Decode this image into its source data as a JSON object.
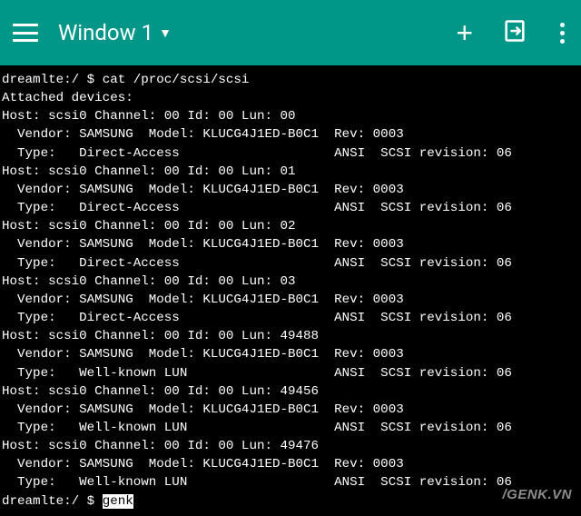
{
  "header": {
    "title": "Window 1"
  },
  "terminal": {
    "prompt1": "dreamlte:/ $ ",
    "command1": "cat /proc/scsi/scsi",
    "attached_line": "Attached devices:",
    "devices": [
      {
        "hostline": "Host: scsi0 Channel: 00 Id: 00 Lun: 00",
        "vendorline": "  Vendor: SAMSUNG  Model: KLUCG4J1ED-B0C1  Rev: 0003",
        "typeline": "  Type:   Direct-Access                    ANSI  SCSI revision: 06"
      },
      {
        "hostline": "Host: scsi0 Channel: 00 Id: 00 Lun: 01",
        "vendorline": "  Vendor: SAMSUNG  Model: KLUCG4J1ED-B0C1  Rev: 0003",
        "typeline": "  Type:   Direct-Access                    ANSI  SCSI revision: 06"
      },
      {
        "hostline": "Host: scsi0 Channel: 00 Id: 00 Lun: 02",
        "vendorline": "  Vendor: SAMSUNG  Model: KLUCG4J1ED-B0C1  Rev: 0003",
        "typeline": "  Type:   Direct-Access                    ANSI  SCSI revision: 06"
      },
      {
        "hostline": "Host: scsi0 Channel: 00 Id: 00 Lun: 03",
        "vendorline": "  Vendor: SAMSUNG  Model: KLUCG4J1ED-B0C1  Rev: 0003",
        "typeline": "  Type:   Direct-Access                    ANSI  SCSI revision: 06"
      },
      {
        "hostline": "Host: scsi0 Channel: 00 Id: 00 Lun: 49488",
        "vendorline": "  Vendor: SAMSUNG  Model: KLUCG4J1ED-B0C1  Rev: 0003",
        "typeline": "  Type:   Well-known LUN                   ANSI  SCSI revision: 06"
      },
      {
        "hostline": "Host: scsi0 Channel: 00 Id: 00 Lun: 49456",
        "vendorline": "  Vendor: SAMSUNG  Model: KLUCG4J1ED-B0C1  Rev: 0003",
        "typeline": "  Type:   Well-known LUN                   ANSI  SCSI revision: 06"
      },
      {
        "hostline": "Host: scsi0 Channel: 00 Id: 00 Lun: 49476",
        "vendorline": "  Vendor: SAMSUNG  Model: KLUCG4J1ED-B0C1  Rev: 0003",
        "typeline": "  Type:   Well-known LUN                   ANSI  SCSI revision: 06"
      }
    ],
    "prompt2": "dreamlte:/ $ ",
    "input2": "genk"
  },
  "watermark": "/GENK.VN"
}
